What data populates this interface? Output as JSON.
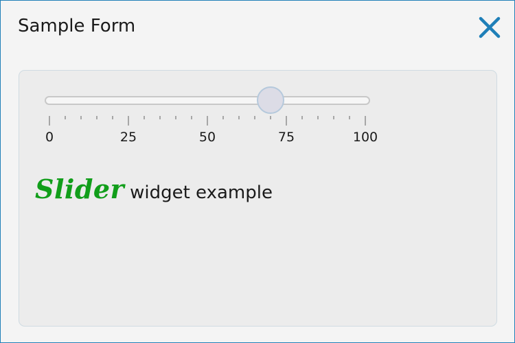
{
  "window": {
    "title": "Sample Form",
    "close_icon": "close-icon",
    "accent_color": "#1f7fb8"
  },
  "slider": {
    "min": 0,
    "max": 100,
    "value": 70,
    "major_tick_labels": [
      "0",
      "25",
      "50",
      "75",
      "100"
    ],
    "minor_tick_step": 5,
    "major_tick_step": 25
  },
  "caption": {
    "highlight": "Slider",
    "highlight_color": "#119e1a",
    "rest": "widget example"
  }
}
